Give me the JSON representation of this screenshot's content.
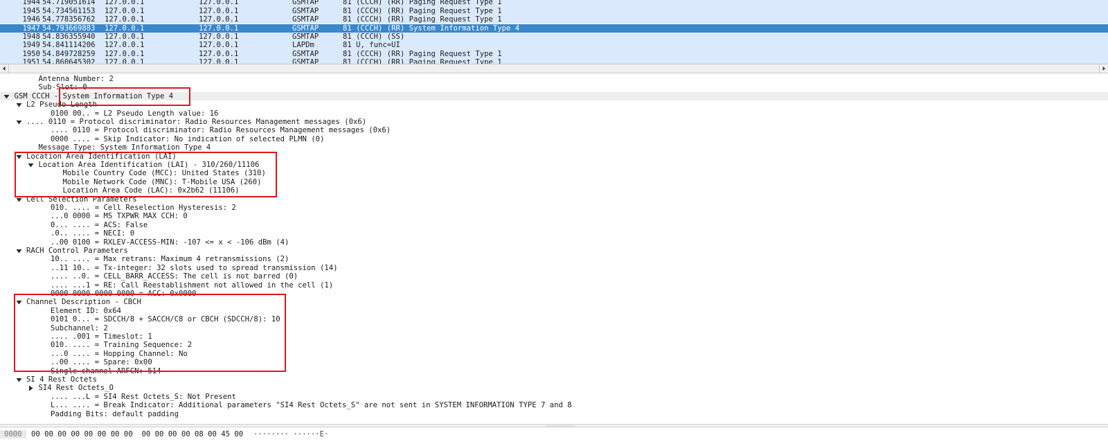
{
  "packets": [
    {
      "no": "1944",
      "time": "54.719051614",
      "src": "127.0.0.1",
      "dst": "127.0.0.1",
      "proto": "GSMTAP",
      "info": "81 (CCCH) (RR) Paging Request Type 1",
      "selected": false
    },
    {
      "no": "1945",
      "time": "54.734561153",
      "src": "127.0.0.1",
      "dst": "127.0.0.1",
      "proto": "GSMTAP",
      "info": "81 (CCCH) (RR) Paging Request Type 1",
      "selected": false
    },
    {
      "no": "1946",
      "time": "54.778356762",
      "src": "127.0.0.1",
      "dst": "127.0.0.1",
      "proto": "GSMTAP",
      "info": "81 (CCCH) (RR) Paging Request Type 1",
      "selected": false
    },
    {
      "no": "1947",
      "time": "54.793669883",
      "src": "127.0.0.1",
      "dst": "127.0.0.1",
      "proto": "GSMTAP",
      "info": "81 (CCCH) (RR) System Information Type 4",
      "selected": true
    },
    {
      "no": "1948",
      "time": "54.836355940",
      "src": "127.0.0.1",
      "dst": "127.0.0.1",
      "proto": "GSMTAP",
      "info": "81 (CCCH) (SS)",
      "selected": false
    },
    {
      "no": "1949",
      "time": "54.841114206",
      "src": "127.0.0.1",
      "dst": "127.0.0.1",
      "proto": "LAPDm",
      "info": "81 U, func=UI",
      "selected": false
    },
    {
      "no": "1950",
      "time": "54.849728259",
      "src": "127.0.0.1",
      "dst": "127.0.0.1",
      "proto": "GSMTAP",
      "info": "81 (CCCH) (RR) Paging Request Type 1",
      "selected": false
    },
    {
      "no": "1951",
      "time": "54.860645302",
      "src": "127.0.0.1",
      "dst": "127.0.0.1",
      "proto": "GSMTAP",
      "info": "81 (CCCH) (RR) Paging Request Type 1",
      "selected": false
    }
  ],
  "details": [
    {
      "level": 2,
      "toggle": "none",
      "text": "Antenna Number: 2"
    },
    {
      "level": 2,
      "toggle": "none",
      "text": "Sub-Slot: 0"
    },
    {
      "level": 0,
      "toggle": "expanded",
      "text": "GSM CCCH - System Information Type 4",
      "highlight": true
    },
    {
      "level": 1,
      "toggle": "expanded",
      "text": "L2 Pseudo Length"
    },
    {
      "level": 3,
      "toggle": "none",
      "text": "0100 00.. = L2 Pseudo Length value: 16"
    },
    {
      "level": 1,
      "toggle": "expanded",
      "text": ".... 0110 = Protocol discriminator: Radio Resources Management messages (0x6)"
    },
    {
      "level": 3,
      "toggle": "none",
      "text": ".... 0110 = Protocol discriminator: Radio Resources Management messages (0x6)"
    },
    {
      "level": 3,
      "toggle": "none",
      "text": "0000 .... = Skip Indicator: No indication of selected PLMN (0)"
    },
    {
      "level": 2,
      "toggle": "none",
      "text": "Message Type: System Information Type 4"
    },
    {
      "level": 1,
      "toggle": "expanded",
      "text": "Location Area Identification (LAI)"
    },
    {
      "level": 2,
      "toggle": "expanded",
      "text": "Location Area Identification (LAI) - 310/260/11106"
    },
    {
      "level": 4,
      "toggle": "none",
      "text": "Mobile Country Code (MCC): United States (310)"
    },
    {
      "level": 4,
      "toggle": "none",
      "text": "Mobile Network Code (MNC): T-Mobile USA (260)"
    },
    {
      "level": 4,
      "toggle": "none",
      "text": "Location Area Code (LAC): 0x2b62 (11106)"
    },
    {
      "level": 1,
      "toggle": "expanded",
      "text": "Cell Selection Parameters"
    },
    {
      "level": 3,
      "toggle": "none",
      "text": "010. .... = Cell Reselection Hysteresis: 2"
    },
    {
      "level": 3,
      "toggle": "none",
      "text": "...0 0000 = MS TXPWR MAX CCH: 0"
    },
    {
      "level": 3,
      "toggle": "none",
      "text": "0... .... = ACS: False"
    },
    {
      "level": 3,
      "toggle": "none",
      "text": ".0.. .... = NECI: 0"
    },
    {
      "level": 3,
      "toggle": "none",
      "text": "..00 0100 = RXLEV-ACCESS-MIN: -107 <= x < -106 dBm (4)"
    },
    {
      "level": 1,
      "toggle": "expanded",
      "text": "RACH Control Parameters"
    },
    {
      "level": 3,
      "toggle": "none",
      "text": "10.. .... = Max retrans: Maximum 4 retransmissions (2)"
    },
    {
      "level": 3,
      "toggle": "none",
      "text": "..11 10.. = Tx-integer: 32 slots used to spread transmission (14)"
    },
    {
      "level": 3,
      "toggle": "none",
      "text": ".... ..0. = CELL_BARR_ACCESS: The cell is not barred (0)"
    },
    {
      "level": 3,
      "toggle": "none",
      "text": ".... ...1 = RE: Call Reestablishment not allowed in the cell (1)"
    },
    {
      "level": 3,
      "toggle": "none",
      "text": "0000 0000 0000 0000 = ACC: 0x0000"
    },
    {
      "level": 1,
      "toggle": "expanded",
      "text": "Channel Description - CBCH"
    },
    {
      "level": 3,
      "toggle": "none",
      "text": "Element ID: 0x64"
    },
    {
      "level": 3,
      "toggle": "none",
      "text": "0101 0... = SDCCH/8 + SACCH/C8 or CBCH (SDCCH/8): 10"
    },
    {
      "level": 3,
      "toggle": "none",
      "text": "Subchannel: 2"
    },
    {
      "level": 3,
      "toggle": "none",
      "text": ".... .001 = Timeslot: 1"
    },
    {
      "level": 3,
      "toggle": "none",
      "text": "010. .... = Training Sequence: 2"
    },
    {
      "level": 3,
      "toggle": "none",
      "text": "...0 .... = Hopping Channel: No"
    },
    {
      "level": 3,
      "toggle": "none",
      "text": "..00 .... = Spare: 0x00"
    },
    {
      "level": 3,
      "toggle": "none",
      "text": "Single channel ARFCN: 514"
    },
    {
      "level": 1,
      "toggle": "expanded",
      "text": "SI 4 Rest Octets"
    },
    {
      "level": 2,
      "toggle": "collapsed",
      "text": "SI4 Rest Octets_O"
    },
    {
      "level": 3,
      "toggle": "none",
      "text": ".... ...L = SI4 Rest Octets_S: Not Present"
    },
    {
      "level": 3,
      "toggle": "none",
      "text": "L... .... = Break Indicator: Additional parameters \"SI4 Rest Octets_S\" are not sent in SYSTEM INFORMATION TYPE 7 and 8"
    },
    {
      "level": 3,
      "toggle": "none",
      "text": "Padding Bits: default padding"
    }
  ],
  "bytes": {
    "offset": "0000",
    "hex": "00 00 00 00 00 00 00 00  00 00 00 00 08 00 45 00",
    "ascii": "········ ······E·"
  },
  "colors": {
    "row_bg": "#dae9fb",
    "selected_bg": "#3a87cc",
    "annotation_box": "#e0141c",
    "highlight_row": "#eeeeee"
  },
  "icons": {
    "expanded": "triangle-down-icon",
    "collapsed": "triangle-right-icon",
    "scroll_left": "scroll-left-arrow-icon",
    "scroll_right": "scroll-right-arrow-icon"
  }
}
